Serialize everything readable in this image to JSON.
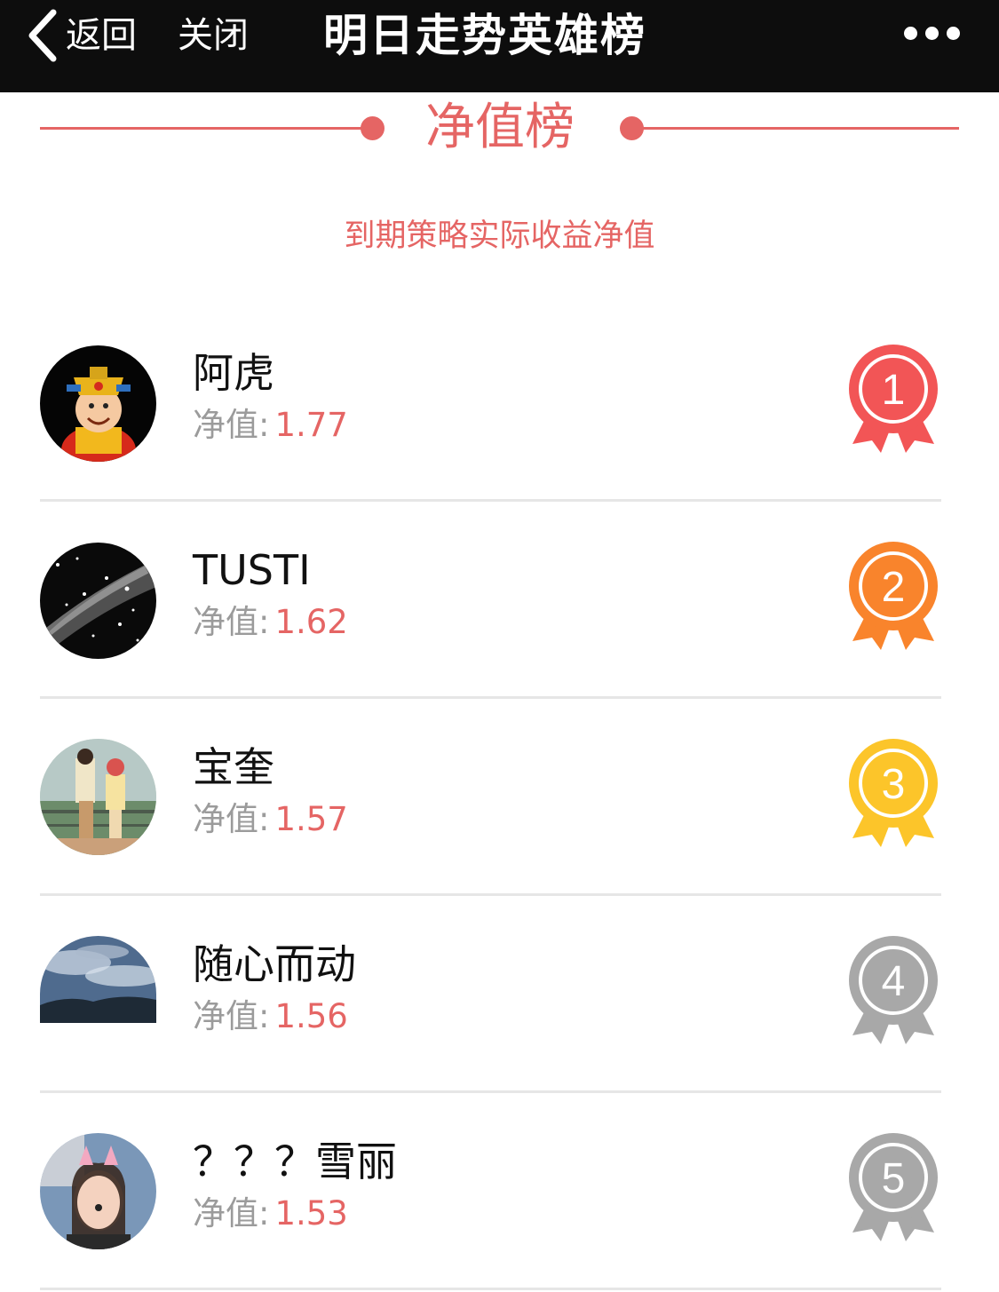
{
  "navbar": {
    "back_label": "返回",
    "close_label": "关闭",
    "title": "明日走势英雄榜",
    "more_icon": "more-dots-icon"
  },
  "section": {
    "title": "净值榜",
    "subtitle": "到期策略实际收益净值"
  },
  "ranking": [
    {
      "rank": "1",
      "name": "阿虎",
      "nav_label": "净值:",
      "nav_value": "1.77",
      "medal_color": "#f25556",
      "avatar": "caishen-avatar"
    },
    {
      "rank": "2",
      "name": "TUSTI",
      "nav_label": "净值:",
      "nav_value": "1.62",
      "medal_color": "#f9842c",
      "avatar": "starfield-avatar"
    },
    {
      "rank": "3",
      "name": "宝奎",
      "nav_label": "净值:",
      "nav_value": "1.57",
      "medal_color": "#fcc52a",
      "avatar": "couple-illustration-avatar"
    },
    {
      "rank": "4",
      "name": "随心而动",
      "nav_label": "净值:",
      "nav_value": "1.56",
      "medal_color": "#a8a8a8",
      "avatar": "cloudy-sky-avatar"
    },
    {
      "rank": "5",
      "name": "？？？雪丽",
      "nav_label": "净值:",
      "nav_value": "1.53",
      "medal_color": "#a8a8a8",
      "avatar": "selfie-avatar"
    }
  ],
  "colors": {
    "accent": "#e56564",
    "navbar_bg": "#0d0d0d",
    "label_gray": "#9b9b9b"
  }
}
